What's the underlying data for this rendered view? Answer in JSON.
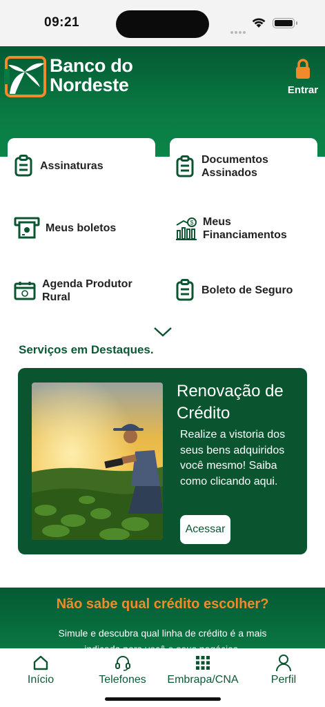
{
  "status_bar": {
    "time": "09:21"
  },
  "header": {
    "brand_line1": "Banco do",
    "brand_line2": "Nordeste",
    "login_label": "Entrar",
    "accent_color": "#f08a2a",
    "brand_color": "#0a5530"
  },
  "menu": {
    "items": [
      {
        "label": "Assinaturas",
        "icon": "clipboard-icon"
      },
      {
        "label": "Documentos Assinados",
        "icon": "clipboard-icon"
      },
      {
        "label": "Meus boletos",
        "icon": "atm-cash-icon"
      },
      {
        "label": "Meus Financiamentos",
        "icon": "financing-chart-icon"
      },
      {
        "label": "Agenda Produtor Rural",
        "icon": "calendar-icon"
      },
      {
        "label": "Boleto de Seguro",
        "icon": "clipboard-icon"
      }
    ],
    "expand_icon": "chevron-down-icon"
  },
  "featured": {
    "section_title": "Serviços em Destaques.",
    "card_title": "Renovação de Crédito",
    "card_description": "Realize a vistoria dos seus bens adquiridos você mesmo! Saiba como clicando aqui.",
    "button_label": "Acessar"
  },
  "credit_banner": {
    "title": "Não sabe qual crédito escolher?",
    "subtitle": "Simule e descubra qual linha de crédito é a mais indicada para você e seus negócios."
  },
  "tab_bar": {
    "tabs": [
      {
        "label": "Início",
        "icon": "home-icon"
      },
      {
        "label": "Telefones",
        "icon": "headset-icon"
      },
      {
        "label": "Embrapa/CNA",
        "icon": "grid-icon"
      },
      {
        "label": "Perfil",
        "icon": "user-icon"
      }
    ]
  }
}
